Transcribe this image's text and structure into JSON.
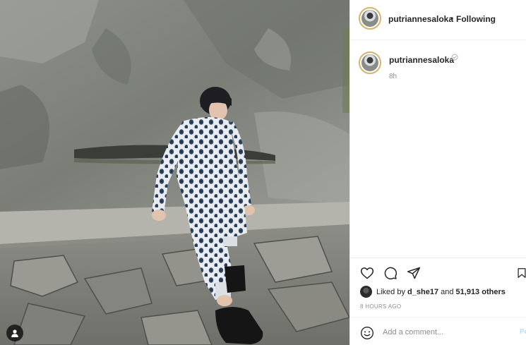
{
  "post": {
    "username": "putriannesaloka",
    "follow_separator": "•",
    "follow_status": "Following",
    "caption_time": "8h",
    "liked_prefix": "Liked by ",
    "liked_user": "d_she17",
    "liked_middle": " and ",
    "liked_count": "51,913 others",
    "posted_ago": "8 HOURS AGO"
  },
  "comment_box": {
    "placeholder": "Add a comment...",
    "post_label": "Post"
  },
  "icons": {
    "like": "heart-icon",
    "comment": "comment-icon",
    "share": "share-icon",
    "save": "bookmark-icon",
    "emoji": "emoji-icon",
    "tag": "user-tag-icon",
    "verified": "verified-icon"
  },
  "colors": {
    "text": "#262626",
    "secondary": "#8e8e8e",
    "border": "#efefef",
    "post_button": "#b2dffc",
    "story_ring": "#d6b56a"
  }
}
